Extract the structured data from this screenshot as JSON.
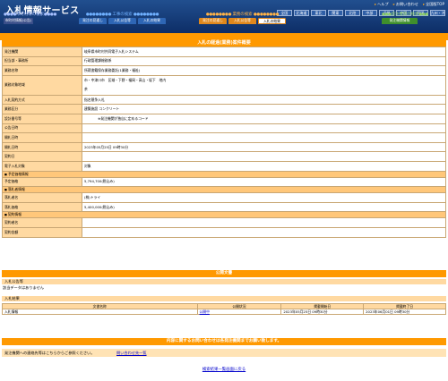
{
  "header": {
    "title": "入札情報サービス",
    "links": [
      "ヘルプ",
      "お問い合わせ",
      "全国版TOP"
    ],
    "regions": [
      "全国",
      "北海道",
      "東北",
      "関東",
      "北陸",
      "中部",
      "近畿",
      "中国",
      "四国",
      "九州・沖縄"
    ]
  },
  "groups": [
    {
      "title": "市町村等の検索",
      "tabs": [
        "市町村情報(公告)"
      ]
    },
    {
      "title": "工事の検索",
      "tabs": [
        "発注の見通し",
        "入札公告等",
        "入札の結果"
      ]
    },
    {
      "title": "業務の検索",
      "tabs": [
        "発注の見通し",
        "入札公告等",
        "入札の結果"
      ]
    },
    {
      "title": "発注機関の検索",
      "tabs": [
        "発注機関情報"
      ]
    }
  ],
  "main": {
    "section_title": "入札の経過(業務)案件概要",
    "rows": [
      {
        "label": "発注機関",
        "value": "岐阜県市町村共同電子入札システム"
      },
      {
        "label": "担当部・事務所",
        "value": "行政管理課総務係"
      },
      {
        "label": "業務名称",
        "value": "所蔵書籍保存業務委託(1業務・福祉)"
      },
      {
        "label": "業務対象地域",
        "value": "市・中津川市　区域・下野・福岡・高山・坂下　地内",
        "value2": "茶"
      },
      {
        "label": "入札契約方式",
        "value": "指名競争入札"
      },
      {
        "label": "業務区分",
        "value": "建築施設 コンクリート"
      },
      {
        "label": "設計番号等",
        "value": "　　　　※発注機関が独自に定めるコード"
      },
      {
        "label": "公告日時",
        "value": ""
      },
      {
        "label": "開札日時",
        "value": ""
      },
      {
        "label": "開札日時",
        "value": "2023年05月25日 09時30分"
      },
      {
        "label": "契約日",
        "value": ""
      },
      {
        "label": "電子入札対象",
        "value": "対象"
      }
    ],
    "sub_price": "予定価格情報",
    "price_rows": [
      {
        "label": "予定価格",
        "value": "5,794,700(税込み)"
      }
    ],
    "sub_winner": "落札者情報",
    "winner_rows": [
      {
        "label": "落札者名",
        "value": "(株)トライ"
      },
      {
        "label": "落札価格",
        "value": "5,400,000(税込み)"
      }
    ],
    "sub_contract": "契約情報",
    "contract_rows": [
      {
        "label": "契約者名",
        "value": ""
      },
      {
        "label": "契約金額",
        "value": ""
      }
    ]
  },
  "notices": {
    "title": "公開文書",
    "announcement_head": "入札公告等",
    "announcement_text": "該当データはありません",
    "result_head": "入札結果",
    "columns": [
      "文書名称",
      "公開状況",
      "掲載開始日",
      "掲載終了日"
    ],
    "rows": [
      {
        "name": "入札情報",
        "status": "公開中",
        "start": "2023年05月25日 09時30分",
        "end": "2023年06月01日 09時30分"
      }
    ]
  },
  "contact": {
    "bar": "内容に関するお問い合わせは各発注機関までお願い致します。",
    "text": "発注機関への連絡先等はこちらからご参照ください。",
    "link": "問い合わせ先一覧"
  },
  "back_link": "検索結果一覧画面に戻る",
  "colors": {
    "header_bg": "#16407a",
    "accent_orange": "#ff9900",
    "label_bg": "#ffd9a1",
    "tab_municipal": "#3a4f8a",
    "tab_construction": "#2e66b5",
    "tab_service": "#e0881c",
    "tab_agency": "#3f8f2c"
  }
}
